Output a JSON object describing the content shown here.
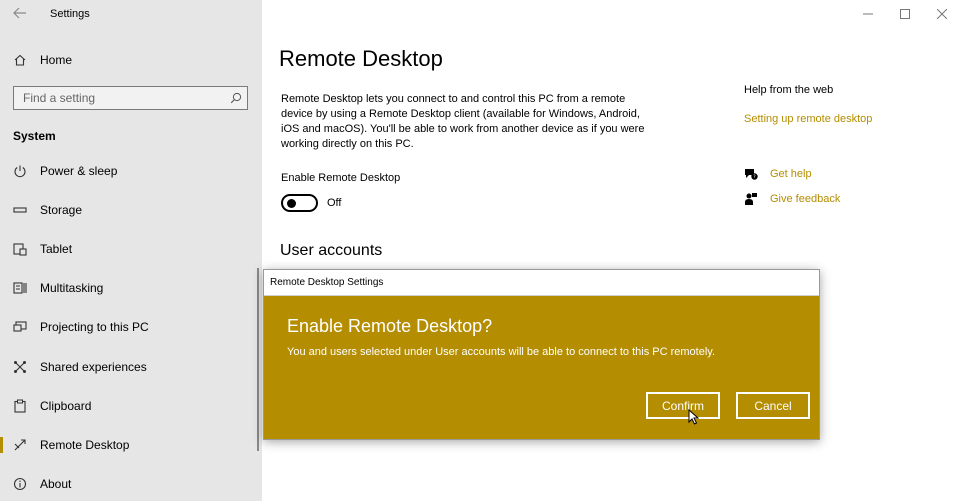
{
  "window": {
    "app_title": "Settings",
    "controls": {
      "minimize": "—",
      "maximize": "☐",
      "close": "✕"
    }
  },
  "sidebar": {
    "home_label": "Home",
    "search_placeholder": "Find a setting",
    "section": "System",
    "items": [
      {
        "label": "Power & sleep",
        "icon": "power-icon"
      },
      {
        "label": "Storage",
        "icon": "storage-icon"
      },
      {
        "label": "Tablet",
        "icon": "tablet-icon"
      },
      {
        "label": "Multitasking",
        "icon": "multitasking-icon"
      },
      {
        "label": "Projecting to this PC",
        "icon": "projecting-icon"
      },
      {
        "label": "Shared experiences",
        "icon": "shared-experiences-icon"
      },
      {
        "label": "Clipboard",
        "icon": "clipboard-icon"
      },
      {
        "label": "Remote Desktop",
        "icon": "remote-desktop-icon",
        "active": true
      },
      {
        "label": "About",
        "icon": "info-icon"
      }
    ]
  },
  "main": {
    "title": "Remote Desktop",
    "description": "Remote Desktop lets you connect to and control this PC from a remote device by using a Remote Desktop client (available for Windows, Android, iOS and macOS). You'll be able to work from another device as if you were working directly on this PC.",
    "enable_label": "Enable Remote Desktop",
    "toggle_state": "Off",
    "user_accounts_heading": "User accounts"
  },
  "help": {
    "title": "Help from the web",
    "link": "Setting up remote desktop",
    "get_help": "Get help",
    "give_feedback": "Give feedback"
  },
  "dialog": {
    "window_title": "Remote Desktop Settings",
    "heading": "Enable Remote Desktop?",
    "message": "You and users selected under User accounts will be able to connect to this PC remotely.",
    "confirm_label": "Confirm",
    "cancel_label": "Cancel"
  },
  "colors": {
    "accent": "#b48d00",
    "sidebar_bg": "#e6e6e6"
  }
}
